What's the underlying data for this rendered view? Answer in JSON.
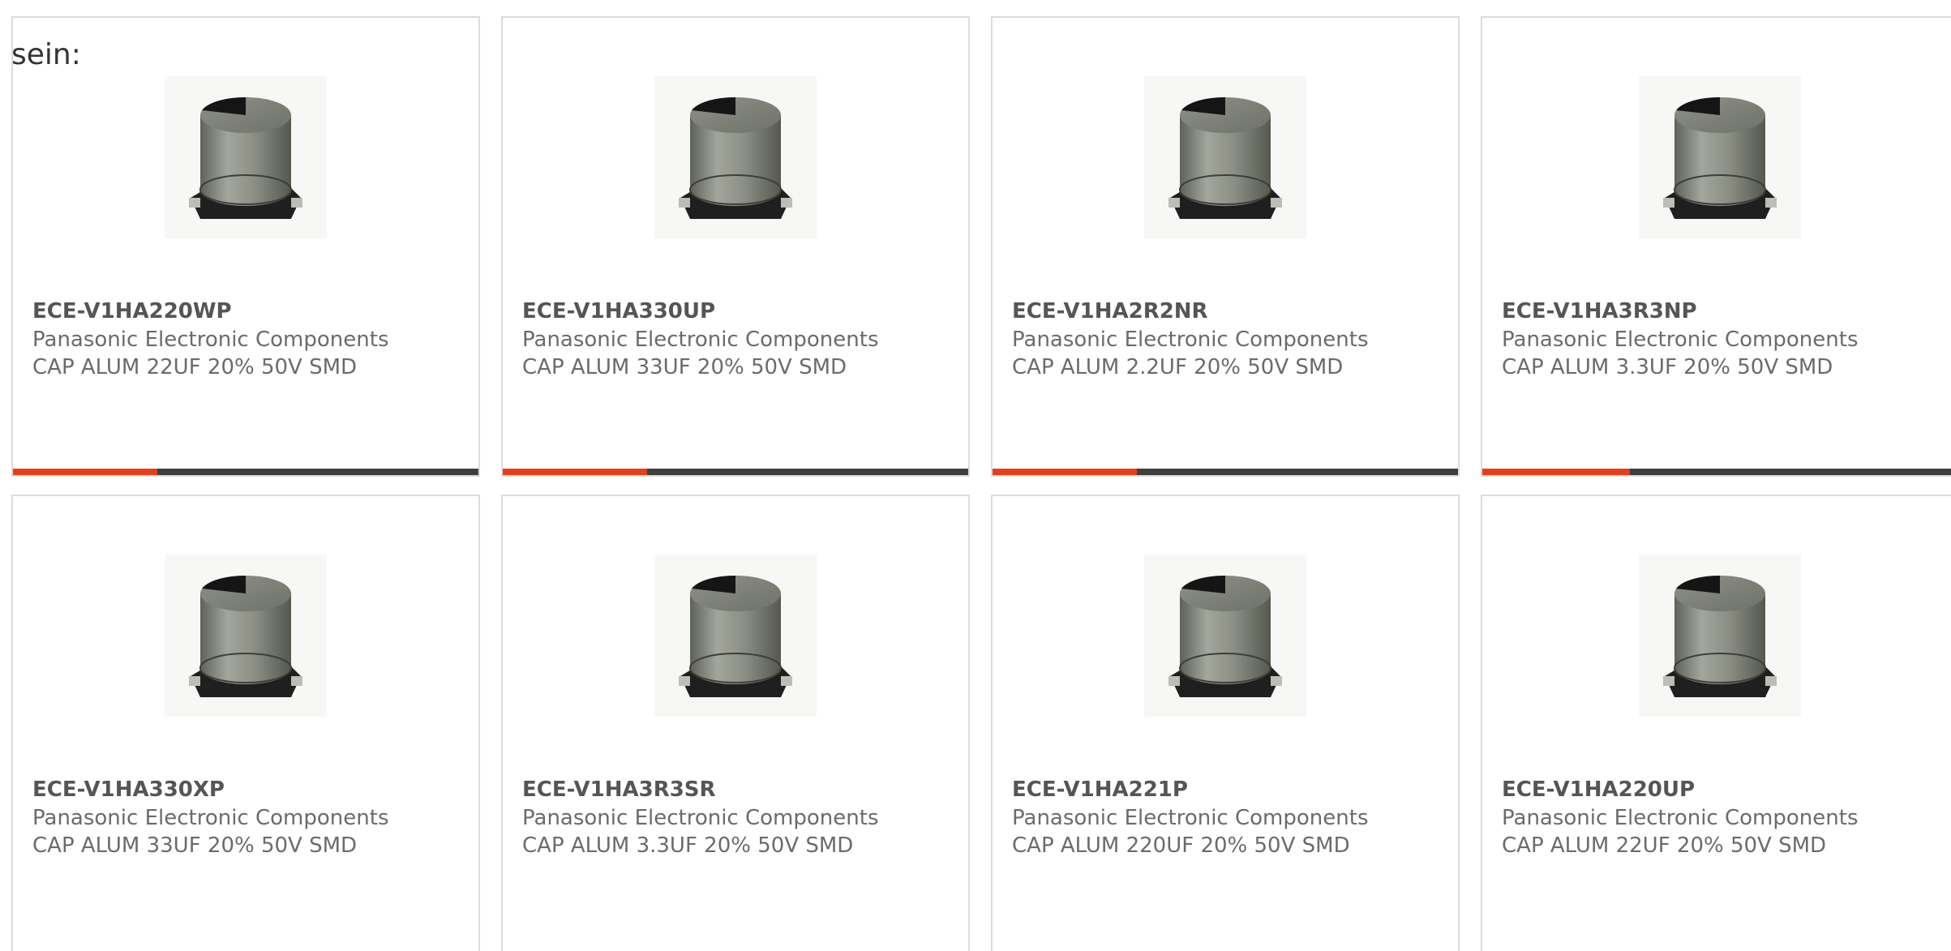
{
  "intro_text": "sein:",
  "colors": {
    "accent": "#e2401c",
    "bar_track": "#3f3f3f",
    "part_number": "#555555",
    "secondary_text": "#6b6b6b",
    "card_border": "#dcdcdc"
  },
  "products": [
    {
      "part_number": "ECE-V1HA220WP",
      "manufacturer": "Panasonic Electronic Components",
      "description": "CAP ALUM 22UF 20% 50V SMD",
      "image_icon": "capacitor-icon",
      "progress_fraction": 0.31
    },
    {
      "part_number": "ECE-V1HA330UP",
      "manufacturer": "Panasonic Electronic Components",
      "description": "CAP ALUM 33UF 20% 50V SMD",
      "image_icon": "capacitor-icon",
      "progress_fraction": 0.31
    },
    {
      "part_number": "ECE-V1HA2R2NR",
      "manufacturer": "Panasonic Electronic Components",
      "description": "CAP ALUM 2.2UF 20% 50V SMD",
      "image_icon": "capacitor-icon",
      "progress_fraction": 0.31
    },
    {
      "part_number": "ECE-V1HA3R3NP",
      "manufacturer": "Panasonic Electronic Components",
      "description": "CAP ALUM 3.3UF 20% 50V SMD",
      "image_icon": "capacitor-icon",
      "progress_fraction": 0.31
    },
    {
      "part_number": "ECE-V1HA330XP",
      "manufacturer": "Panasonic Electronic Components",
      "description": "CAP ALUM 33UF 20% 50V SMD",
      "image_icon": "capacitor-icon"
    },
    {
      "part_number": "ECE-V1HA3R3SR",
      "manufacturer": "Panasonic Electronic Components",
      "description": "CAP ALUM 3.3UF 20% 50V SMD",
      "image_icon": "capacitor-icon"
    },
    {
      "part_number": "ECE-V1HA221P",
      "manufacturer": "Panasonic Electronic Components",
      "description": "CAP ALUM 220UF 20% 50V SMD",
      "image_icon": "capacitor-icon"
    },
    {
      "part_number": "ECE-V1HA220UP",
      "manufacturer": "Panasonic Electronic Components",
      "description": "CAP ALUM 22UF 20% 50V SMD",
      "image_icon": "capacitor-icon"
    }
  ]
}
